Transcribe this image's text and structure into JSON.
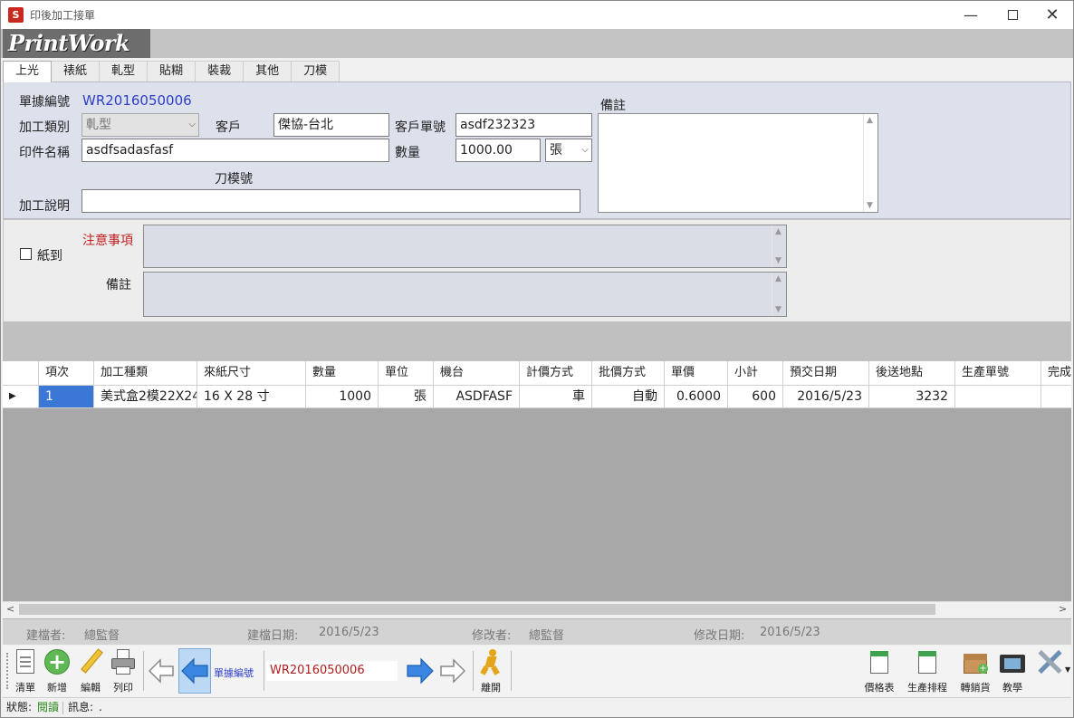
{
  "window": {
    "title": "印後加工接單",
    "app_icon": "app-logo-icon",
    "logo_text": "PrintWork"
  },
  "tabs": [
    {
      "label": "上光",
      "active": true
    },
    {
      "label": "裱紙"
    },
    {
      "label": "軋型"
    },
    {
      "label": "貼糊"
    },
    {
      "label": "裝裁"
    },
    {
      "label": "其他"
    },
    {
      "label": "刀模"
    }
  ],
  "form": {
    "doc_no_label": "單據編號",
    "doc_no": "WR2016050006",
    "process_type_label": "加工類別",
    "process_type": "軋型",
    "customer_label": "客戶",
    "customer": "傑協-台北",
    "customer_no_label": "客戶單號",
    "customer_no": "asdf232323",
    "print_name_label": "印件名稱",
    "print_name": "asdfsadasfasf",
    "qty_label": "數量",
    "qty": "1000.00",
    "unit": "張",
    "die_no_label": "刀模號",
    "desc_label": "加工說明",
    "desc": "",
    "remark_label": "備註",
    "remark": ""
  },
  "notes": {
    "paper_arrived_label": "紙到",
    "paper_arrived": false,
    "attention_label": "注意事項",
    "attention": "",
    "remark_label": "備註",
    "remark": ""
  },
  "grid": {
    "columns": [
      "項次",
      "加工種類",
      "來紙尺寸",
      "數量",
      "單位",
      "機台",
      "計價方式",
      "批價方式",
      "單價",
      "小計",
      "預交日期",
      "後送地點",
      "生產單號",
      "完成"
    ],
    "rows": [
      [
        "1",
        "美式盒2模22X24",
        "16 X 28 寸",
        "1000",
        "張",
        "ASDFASF",
        "車",
        "自動",
        "0.6000",
        "600",
        "2016/5/23",
        "3232",
        "",
        ""
      ]
    ]
  },
  "audit": {
    "creator_label": "建檔者:",
    "creator": "總監督",
    "create_date_label": "建檔日期:",
    "create_date": "2016/5/23",
    "modifier_label": "修改者:",
    "modifier": "總監督",
    "modify_date_label": "修改日期:",
    "modify_date": "2016/5/23"
  },
  "toolbar": {
    "list": "清單",
    "new": "新增",
    "edit": "編輯",
    "print": "列印",
    "nav_label": "單據編號",
    "nav_value": "WR2016050006",
    "exit": "離開",
    "price_list": "價格表",
    "schedule": "生產排程",
    "transfer": "轉銷貨",
    "tutorial": "教學"
  },
  "status": {
    "status_label": "狀態:",
    "status": "閱讀",
    "msg_label": "訊息:",
    "msg": "."
  },
  "colors": {
    "selected_cell": "#3b78d6",
    "attention_red": "#c31e1e",
    "doc_no_blue": "#2d3fc8"
  }
}
